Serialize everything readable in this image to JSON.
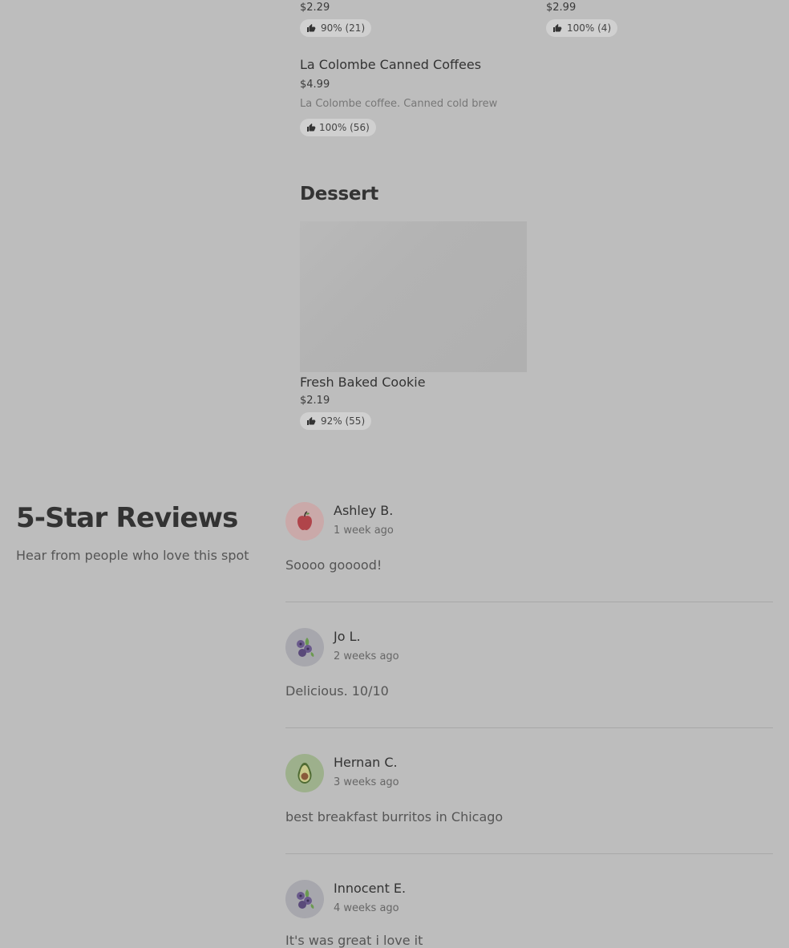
{
  "menu": {
    "top_row": [
      {
        "price": "$2.29",
        "rating": "90% (21)"
      },
      {
        "price": "$2.99",
        "rating": "100% (4)"
      }
    ],
    "coffee": {
      "name": "La Colombe Canned Coffees",
      "price": "$4.99",
      "description": "La Colombe coffee. Canned cold brew",
      "rating": "100% (56)"
    },
    "dessert_section": {
      "title": "Dessert",
      "item": {
        "name": "Fresh Baked Cookie",
        "price": "$2.19",
        "rating": "92% (55)"
      }
    }
  },
  "reviews": {
    "title": "5-Star Reviews",
    "subtitle": "Hear from people who love this spot",
    "items": [
      {
        "name": "Ashley B.",
        "time": "1 week ago",
        "text": "Soooo gooood!",
        "avatar_icon": "apple-icon",
        "avatar_bg": "#caa9a9"
      },
      {
        "name": "Jo L.",
        "time": "2 weeks ago",
        "text": "Delicious. 10/10",
        "avatar_icon": "blueberry-icon",
        "avatar_bg": "#a7a7ad"
      },
      {
        "name": "Hernan C.",
        "time": "3 weeks ago",
        "text": "best breakfast burritos in Chicago",
        "avatar_icon": "avocado-icon",
        "avatar_bg": "#9db08c"
      },
      {
        "name": "Innocent E.",
        "time": "4 weeks ago",
        "text": "It's was great i love it",
        "avatar_icon": "blueberry-icon",
        "avatar_bg": "#a7a7ad"
      }
    ]
  }
}
